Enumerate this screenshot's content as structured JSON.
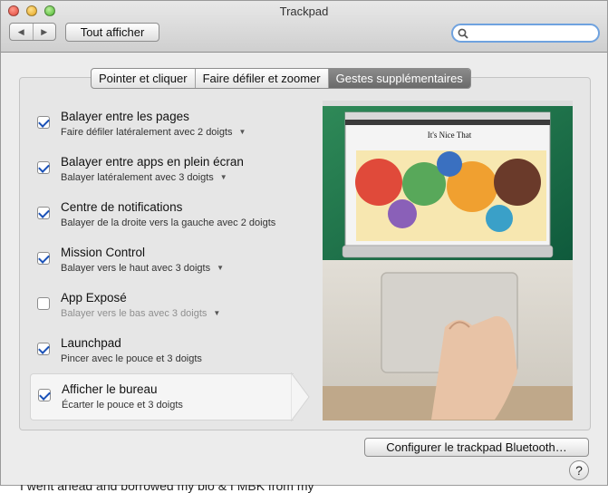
{
  "window": {
    "title": "Trackpad"
  },
  "toolbar": {
    "show_all_label": "Tout afficher",
    "search_value": ""
  },
  "tabs": [
    {
      "label": "Pointer et cliquer",
      "active": false
    },
    {
      "label": "Faire défiler et zoomer",
      "active": false
    },
    {
      "label": "Gestes supplémentaires",
      "active": true
    }
  ],
  "gestures": [
    {
      "title": "Balayer entre les pages",
      "subtitle": "Faire défiler latéralement avec 2 doigts",
      "checked": true,
      "has_menu": true
    },
    {
      "title": "Balayer entre apps en plein écran",
      "subtitle": "Balayer latéralement avec 3 doigts",
      "checked": true,
      "has_menu": true
    },
    {
      "title": "Centre de notifications",
      "subtitle": "Balayer de la droite vers la gauche avec 2 doigts",
      "checked": true,
      "has_menu": false
    },
    {
      "title": "Mission Control",
      "subtitle": "Balayer vers le haut avec 3 doigts",
      "checked": true,
      "has_menu": true
    },
    {
      "title": "App Exposé",
      "subtitle": "Balayer vers le bas avec 3 doigts",
      "checked": false,
      "has_menu": true
    },
    {
      "title": "Launchpad",
      "subtitle": "Pincer avec le pouce et 3 doigts",
      "checked": true,
      "has_menu": false
    },
    {
      "title": "Afficher le bureau",
      "subtitle": "Écarter le pouce et 3 doigts",
      "checked": true,
      "has_menu": false,
      "selected": true
    }
  ],
  "preview": {
    "site_title": "It's Nice That"
  },
  "footer": {
    "bluetooth_button_label": "Configurer le trackpad Bluetooth…",
    "help_label": "?"
  },
  "background_text": "I went ahead and borrowed my bio & I MBK from my"
}
